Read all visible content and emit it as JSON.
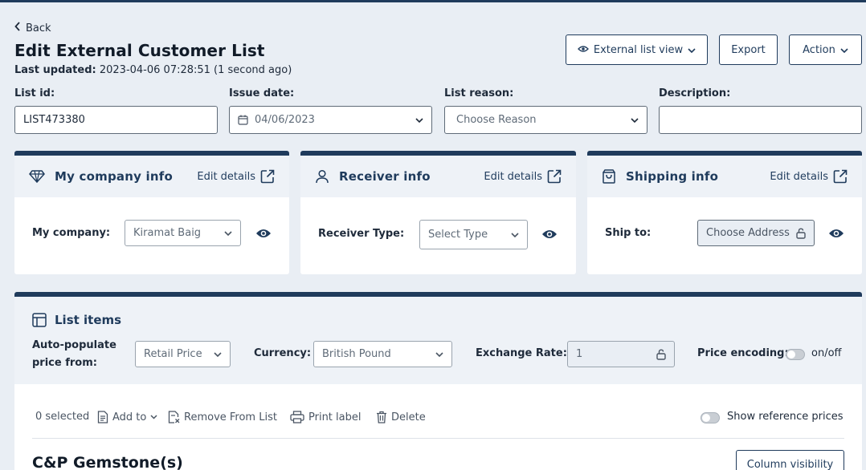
{
  "header": {
    "back_label": "Back",
    "title": "Edit External Customer List",
    "last_updated_label": "Last updated:",
    "last_updated_value": "2023-04-06 07:28:51 (1 second ago)",
    "external_view_label": "External list view",
    "export_label": "Export",
    "action_label": "Action"
  },
  "fields": {
    "list_id": {
      "label": "List id:",
      "value": "LIST473380"
    },
    "issue_date": {
      "label": "Issue date:",
      "value": "04/06/2023"
    },
    "list_reason": {
      "label": "List reason:",
      "placeholder": "Choose Reason"
    },
    "description": {
      "label": "Description:",
      "value": ""
    }
  },
  "cards": {
    "company": {
      "title": "My company info",
      "edit": "Edit details",
      "field_label": "My company:",
      "value": "Kiramat Baig"
    },
    "receiver": {
      "title": "Receiver info",
      "edit": "Edit details",
      "field_label": "Receiver Type:",
      "value": "Select Type"
    },
    "shipping": {
      "title": "Shipping info",
      "edit": "Edit details",
      "field_label": "Ship to:",
      "value": "Choose Address"
    }
  },
  "list_items": {
    "title": "List items",
    "autopop_label_1": "Auto-populate",
    "autopop_label_2": "price from:",
    "autopop_value": "Retail Price",
    "currency_label": "Currency:",
    "currency_value": "British Pound",
    "exchange_label": "Exchange Rate:",
    "exchange_value": "1",
    "price_encoding_label": "Price encoding:",
    "price_encoding_state": "on/off",
    "selected_count": "0 selected",
    "add_to": "Add to",
    "remove": "Remove From List",
    "print": "Print label",
    "delete": "Delete",
    "show_ref": "Show reference prices",
    "section_title": "C&P Gemstone(s)",
    "column_visibility": "Column visibility"
  }
}
